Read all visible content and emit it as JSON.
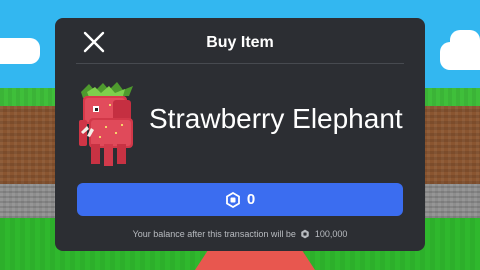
{
  "dialog": {
    "title": "Buy Item",
    "close_icon": "close-icon"
  },
  "item": {
    "name": "Strawberry Elephant",
    "thumbnail_icon": "strawberry-elephant-thumbnail"
  },
  "purchase": {
    "currency_icon": "robux-icon",
    "price": "0"
  },
  "balance": {
    "prefix": "Your balance after this transaction will be",
    "amount": "100,000",
    "currency_icon": "robux-icon"
  },
  "colors": {
    "modal_bg": "#2c2e33",
    "buy_button": "#3b6df0",
    "sky": "#33b7f0",
    "grass": "#3fbf3a",
    "dirt": "#8a5530",
    "stone": "#8d8d8d",
    "red_path": "#e8574f"
  }
}
